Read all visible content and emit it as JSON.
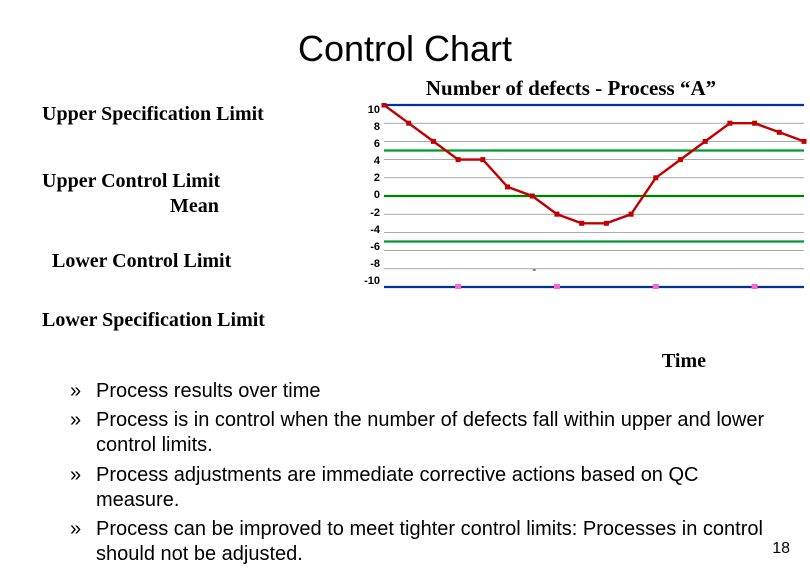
{
  "page_title": "Control Chart",
  "page_number": "18",
  "left_labels": {
    "usl": "Upper Specification Limit",
    "ucl": "Upper Control Limit",
    "mean": "Mean",
    "lcl": "Lower Control Limit",
    "lsl": "Lower Specification Limit"
  },
  "timelabel": "Time",
  "bullets": [
    "Process results over time",
    "Process is in control when the number of defects fall within upper and lower control limits.",
    "Process adjustments are immediate corrective actions based on QC measure.",
    "Process can be improved to meet tighter control limits: Processes in control should not be adjusted."
  ],
  "chart_data": {
    "type": "line",
    "title": "Number of defects - Process “A”",
    "xlabel": "Time",
    "ylabel": "",
    "ylim": [
      -10,
      10
    ],
    "yticks": [
      10,
      8,
      6,
      4,
      2,
      0,
      -2,
      -4,
      -6,
      -8,
      -10
    ],
    "series": [
      {
        "name": "defects",
        "x": [
          1,
          2,
          3,
          4,
          5,
          6,
          7,
          8,
          9,
          10,
          11,
          12,
          13,
          14,
          15,
          16,
          17,
          18
        ],
        "values": [
          10,
          8,
          6,
          4,
          4,
          1,
          0,
          -2,
          -3,
          -3,
          -2,
          2,
          4,
          6,
          8,
          8,
          7,
          6
        ],
        "color": "#c00000"
      }
    ],
    "reference_lines": [
      {
        "name": "usl",
        "value": 10,
        "color": "#003399"
      },
      {
        "name": "ucl",
        "value": 5,
        "color": "#009933"
      },
      {
        "name": "mean",
        "value": 0,
        "color": "#008000"
      },
      {
        "name": "lcl",
        "value": -5,
        "color": "#009933"
      },
      {
        "name": "lsl",
        "value": -10,
        "color": "#003399"
      }
    ],
    "pink_markers": {
      "x": [
        4,
        8,
        12,
        16
      ],
      "y": -10,
      "color": "#ff66cc"
    },
    "dash_annotation": "-"
  }
}
